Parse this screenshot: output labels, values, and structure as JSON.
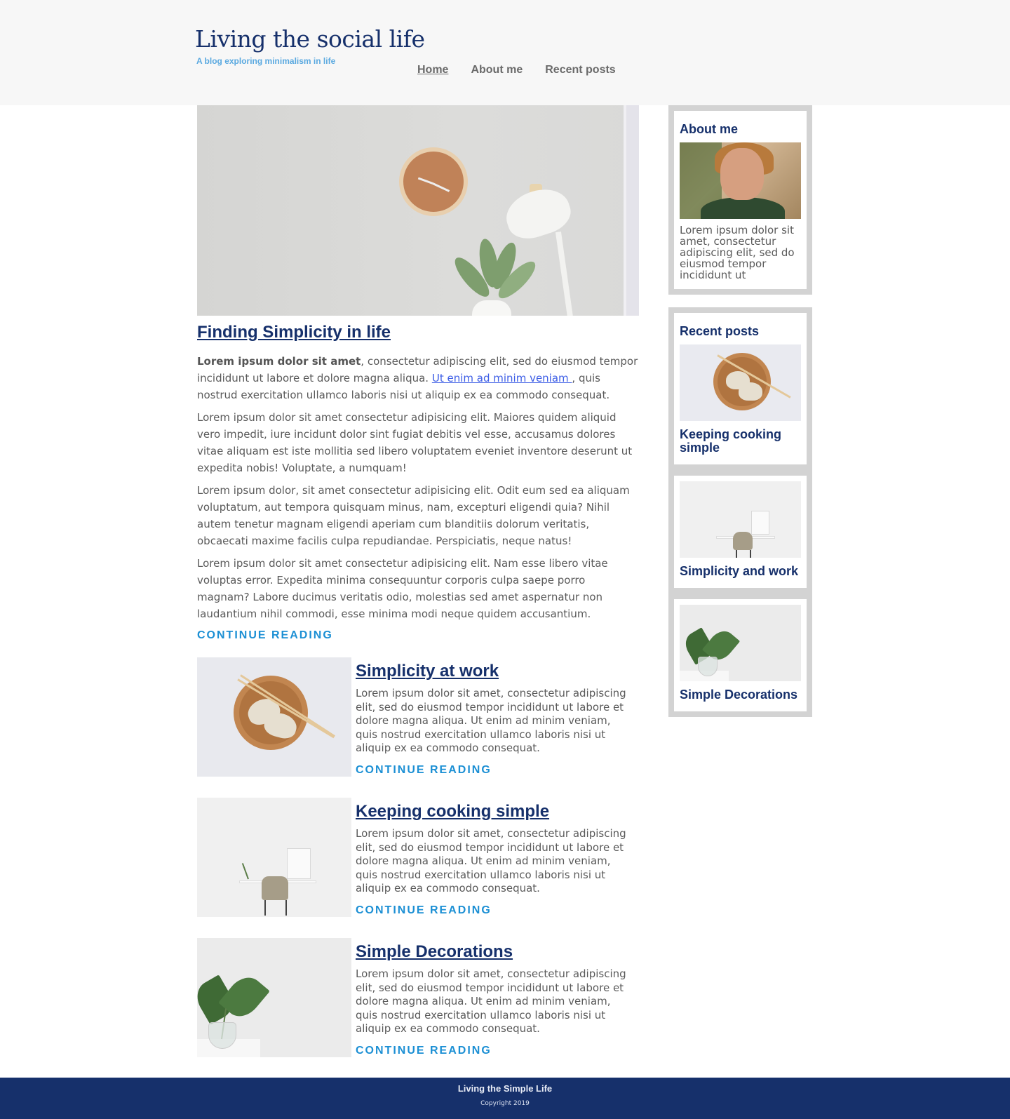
{
  "header": {
    "site_title": "Living the social life",
    "tagline": "A blog exploring minimalism in life",
    "nav": [
      {
        "label": "Home",
        "active": true
      },
      {
        "label": "About me",
        "active": false
      },
      {
        "label": "Recent posts",
        "active": false
      }
    ]
  },
  "featured": {
    "title": "Finding Simplicity in life",
    "p1_bold": "Lorem ipsum dolor sit amet",
    "p1_text1": ", consectetur adipiscing elit, sed do eiusmod tempor incididunt ut labore et dolore magna aliqua. ",
    "p1_link": "Ut enim ad minim veniam ",
    "p1_text2": ", quis nostrud exercitation ullamco laboris nisi ut aliquip ex ea commodo consequat.",
    "p2": "Lorem ipsum dolor sit amet consectetur adipisicing elit. Maiores quidem aliquid vero impedit, iure incidunt dolor sint fugiat debitis vel esse, accusamus dolores vitae aliquam est iste mollitia sed libero voluptatem eveniet inventore deserunt ut expedita nobis! Voluptate, a numquam!",
    "p3": "Lorem ipsum dolor, sit amet consectetur adipisicing elit. Odit eum sed ea aliquam voluptatum, aut tempora quisquam minus, nam, excepturi eligendi quia? Nihil autem tenetur magnam eligendi aperiam cum blanditiis dolorum veritatis, obcaecati maxime facilis culpa repudiandae. Perspiciatis, neque natus!",
    "p4": "Lorem ipsum dolor sit amet consectetur adipisicing elit. Nam esse libero vitae voluptas error. Expedita minima consequuntur corporis culpa saepe porro magnam? Labore ducimus veritatis odio, molestias sed amet aspernatur non laudantium nihil commodi, esse minima modi neque quidem accusantium.",
    "continue": "CONTINUE READING"
  },
  "posts": [
    {
      "title": "Simplicity at work",
      "text": "Lorem ipsum dolor sit amet, consectetur adipiscing elit, sed do eiusmod tempor incididunt ut labore et dolore magna aliqua. Ut enim ad minim veniam, quis nostrud exercitation ullamco laboris nisi ut aliquip ex ea commodo consequat.",
      "continue": "CONTINUE READING",
      "image": "dumplings-bowl"
    },
    {
      "title": "Keeping cooking simple",
      "text": "Lorem ipsum dolor sit amet, consectetur adipiscing elit, sed do eiusmod tempor incididunt ut labore et dolore magna aliqua. Ut enim ad minim veniam, quis nostrud exercitation ullamco laboris nisi ut aliquip ex ea commodo consequat.",
      "continue": "CONTINUE READING",
      "image": "desk-chair"
    },
    {
      "title": "Simple Decorations",
      "text": "Lorem ipsum dolor sit amet, consectetur adipiscing elit, sed do eiusmod tempor incididunt ut labore et dolore magna aliqua. Ut enim ad minim veniam, quis nostrud exercitation ullamco laboris nisi ut aliquip ex ea commodo consequat.",
      "continue": "CONTINUE READING",
      "image": "plant-vase"
    }
  ],
  "sidebar": {
    "about": {
      "title": "About me",
      "text": "Lorem ipsum dolor sit amet, consectetur adipiscing elit, sed do eiusmod tempor incididunt ut"
    },
    "recent": {
      "title": "Recent posts",
      "items": [
        {
          "title": "Keeping cooking simple",
          "image": "dumplings-bowl"
        },
        {
          "title": "Simplicity and work",
          "image": "desk-chair"
        },
        {
          "title": "Simple Decorations",
          "image": "plant-vase"
        }
      ]
    }
  },
  "footer": {
    "title": "Living the Simple Life",
    "copyright": "Copyright 2019"
  },
  "colors": {
    "brand_navy": "#16306b",
    "accent_blue": "#1b8fd4",
    "tagline_blue": "#5aa9e0",
    "sidebar_gray": "#d3d3d3"
  }
}
